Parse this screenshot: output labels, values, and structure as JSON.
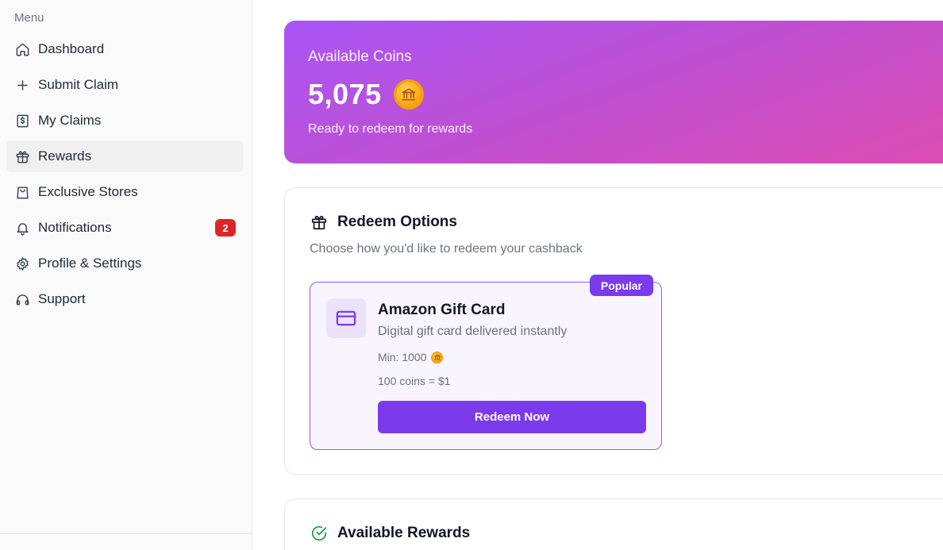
{
  "sidebar": {
    "heading": "Menu",
    "items": [
      {
        "label": "Dashboard",
        "icon": "home-icon"
      },
      {
        "label": "Submit Claim",
        "icon": "plus-icon"
      },
      {
        "label": "My Claims",
        "icon": "receipt-icon"
      },
      {
        "label": "Rewards",
        "icon": "gift-icon",
        "active": true
      },
      {
        "label": "Exclusive Stores",
        "icon": "shopping-bag-icon"
      },
      {
        "label": "Notifications",
        "icon": "bell-icon",
        "badge": "2"
      },
      {
        "label": "Profile & Settings",
        "icon": "gear-icon"
      },
      {
        "label": "Support",
        "icon": "headphones-icon"
      }
    ]
  },
  "coins": {
    "label": "Available Coins",
    "value": "5,075",
    "subtitle": "Ready to redeem for rewards",
    "icon": "coin-icon"
  },
  "redeem": {
    "title": "Redeem Options",
    "subtitle": "Choose how you'd like to redeem your cashback",
    "option": {
      "badge": "Popular",
      "title": "Amazon Gift Card",
      "description": "Digital gift card delivered instantly",
      "min": "Min: 1000",
      "rate": "100 coins = $1",
      "button": "Redeem Now",
      "icon": "credit-card-icon"
    }
  },
  "rewards": {
    "title": "Available Rewards",
    "icon": "check-circle-icon"
  },
  "colors": {
    "accent": "#7c3aed",
    "gradient_start": "#a855f7",
    "gradient_end": "#db4cb1",
    "badge_red": "#dc2626",
    "success": "#16a34a",
    "coin": "#f59e0b"
  }
}
